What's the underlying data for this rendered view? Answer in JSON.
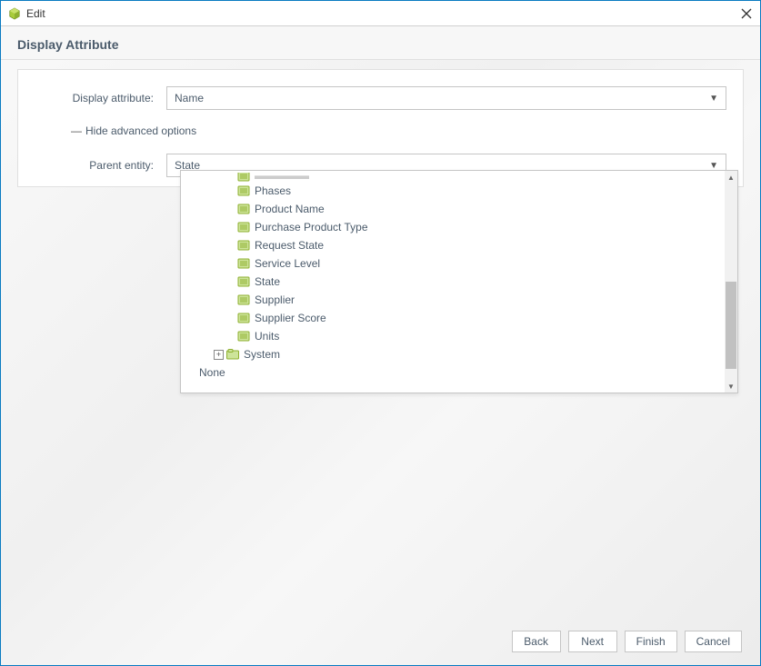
{
  "titlebar": {
    "title": "Edit"
  },
  "header": {
    "title": "Display Attribute"
  },
  "form": {
    "display_attribute_label": "Display attribute:",
    "display_attribute_value": "Name",
    "advanced_toggle": "Hide advanced options",
    "parent_entity_label": "Parent entity:",
    "parent_entity_value": "State"
  },
  "tree": {
    "items": [
      {
        "label": "Phases",
        "indent": 3,
        "type": "leaf"
      },
      {
        "label": "Product Name",
        "indent": 3,
        "type": "leaf"
      },
      {
        "label": "Purchase Product Type",
        "indent": 3,
        "type": "leaf"
      },
      {
        "label": "Request State",
        "indent": 3,
        "type": "leaf"
      },
      {
        "label": "Service Level",
        "indent": 3,
        "type": "leaf"
      },
      {
        "label": "State",
        "indent": 3,
        "type": "leaf"
      },
      {
        "label": "Supplier",
        "indent": 3,
        "type": "leaf"
      },
      {
        "label": "Supplier Score",
        "indent": 3,
        "type": "leaf"
      },
      {
        "label": "Units",
        "indent": 3,
        "type": "leaf"
      },
      {
        "label": "System",
        "indent": 2,
        "type": "folder"
      },
      {
        "label": "None",
        "indent": 1,
        "type": "none"
      }
    ]
  },
  "buttons": {
    "back": "Back",
    "next": "Next",
    "finish": "Finish",
    "cancel": "Cancel"
  }
}
